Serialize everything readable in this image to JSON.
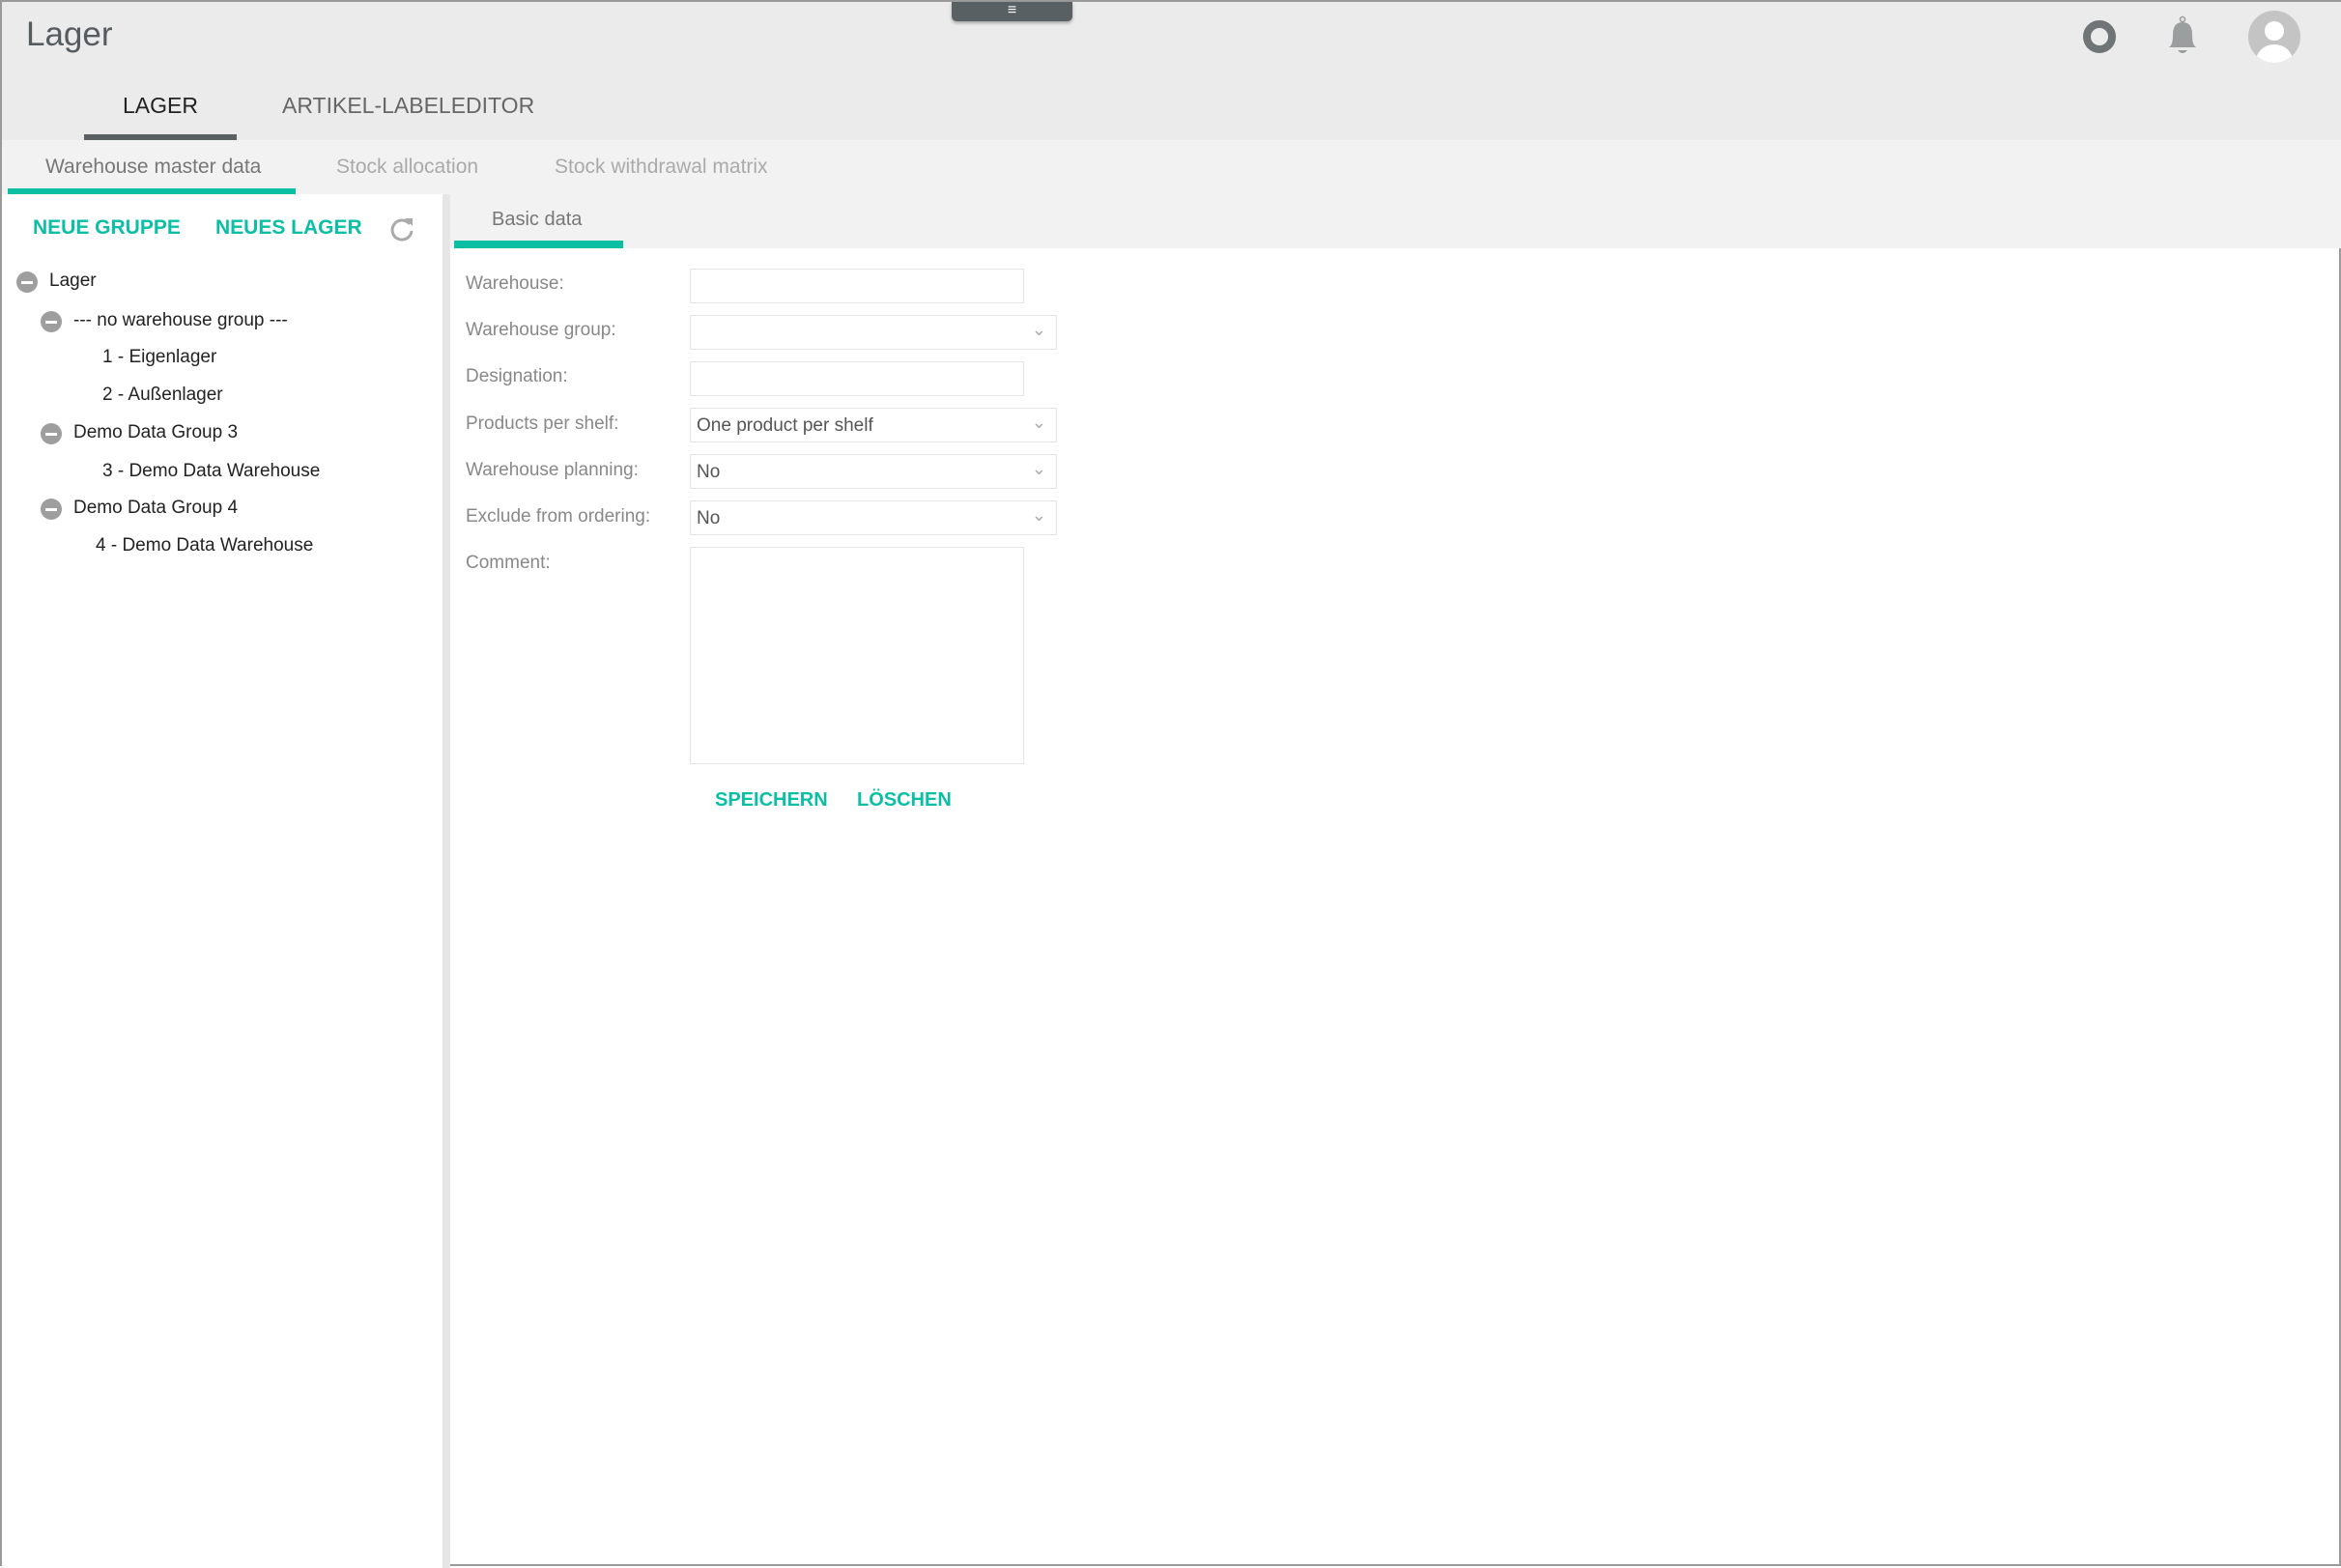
{
  "header": {
    "title": "Lager",
    "menu_icon": "hamburger-icon"
  },
  "main_tabs": [
    {
      "label": "LAGER",
      "active": true
    },
    {
      "label": "ARTIKEL-LABELEDITOR",
      "active": false
    }
  ],
  "sub_tabs": [
    {
      "label": "Warehouse master data",
      "active": true
    },
    {
      "label": "Stock allocation"
    },
    {
      "label": "Stock withdrawal matrix"
    }
  ],
  "toolbar": {
    "new_group": "NEUE GRUPPE",
    "new_warehouse": "NEUES LAGER",
    "refresh_icon": "refresh-icon"
  },
  "tree": [
    {
      "label": "Lager",
      "level": 0,
      "collapsible": true
    },
    {
      "label": "--- no warehouse group ---",
      "level": 1,
      "collapsible": true
    },
    {
      "label": "1 - Eigenlager",
      "level": 2
    },
    {
      "label": "2 - Außenlager",
      "level": 2
    },
    {
      "label": "Demo Data Group 3",
      "level": 1,
      "collapsible": true
    },
    {
      "label": "3 - Demo Data Warehouse",
      "level": 2
    },
    {
      "label": "Demo Data Group 4",
      "level": 1,
      "collapsible": true
    },
    {
      "label": "4 - Demo Data Warehouse",
      "level": 2
    }
  ],
  "detail_tab": "Basic data",
  "form": {
    "warehouse": {
      "label": "Warehouse:",
      "value": ""
    },
    "warehouse_group": {
      "label": "Warehouse group:",
      "value": ""
    },
    "designation": {
      "label": "Designation:",
      "value": ""
    },
    "products_per_shelf": {
      "label": "Products per shelf:",
      "value": "One product per shelf"
    },
    "warehouse_planning": {
      "label": "Warehouse planning:",
      "value": "No"
    },
    "exclude_from_ordering": {
      "label": "Exclude from ordering:",
      "value": "No"
    },
    "comment": {
      "label": "Comment:",
      "value": ""
    }
  },
  "actions": {
    "save": "SPEICHERN",
    "delete": "LÖSCHEN"
  },
  "colors": {
    "accent": "#0bbfa5",
    "header_bg": "#ebebeb"
  }
}
